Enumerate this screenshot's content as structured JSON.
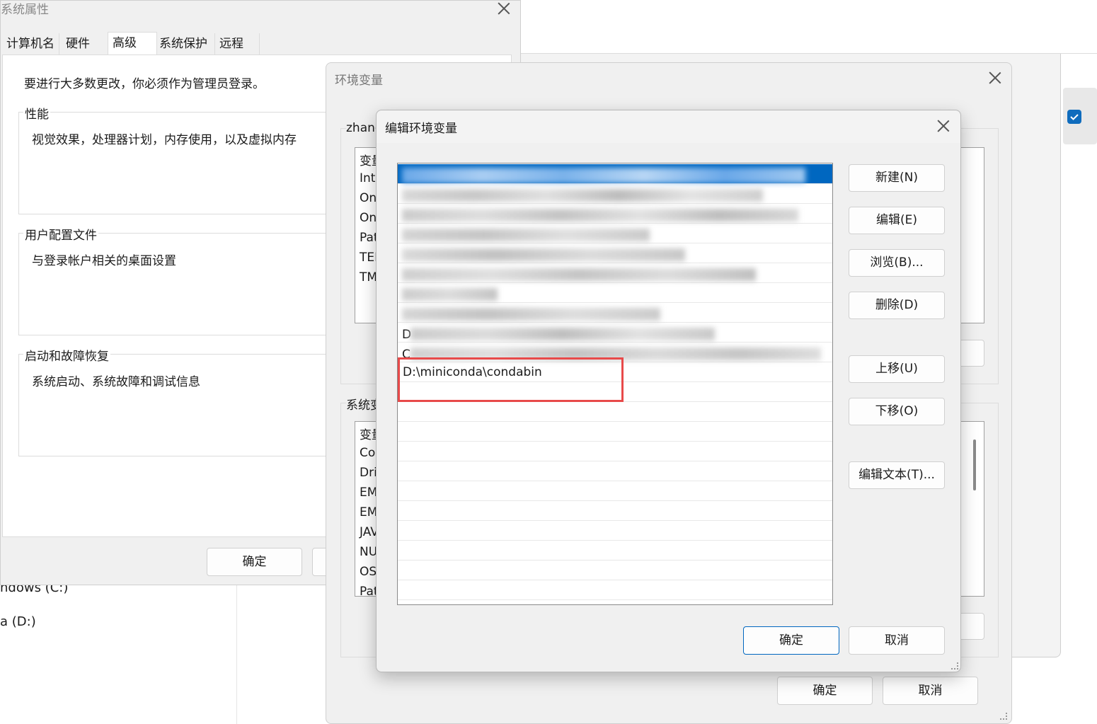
{
  "sys_props": {
    "title": "系统属性",
    "tabs": [
      "计算机名",
      "硬件",
      "高级",
      "系统保护",
      "远程"
    ],
    "admin_notice": "要进行大多数更改，你必须作为管理员登录。",
    "performance": {
      "title": "性能",
      "desc": "视觉效果，处理器计划，内存使用，以及虚拟内存"
    },
    "user_profiles": {
      "title": "用户配置文件",
      "desc": "与登录帐户相关的桌面设置"
    },
    "startup": {
      "title": "启动和故障恢复",
      "desc": "系统启动、系统故障和调试信息"
    },
    "ok_label": "确定"
  },
  "explorer_bg": {
    "drives": [
      "ndows (C:)",
      "a (D:)"
    ]
  },
  "env_vars": {
    "title": "环境变量",
    "user_section_label": "zhang",
    "user_vars_partial": [
      "变量",
      "Int",
      "On",
      "On",
      "Pat",
      "TEI",
      "TM"
    ],
    "system_section_label": "系统变",
    "system_vars_partial": [
      "变量",
      "Co",
      "Dri",
      "EM",
      "EM",
      "JAV",
      "NU",
      "OS",
      "Pat"
    ],
    "ok_label": "确定",
    "cancel_label": "取消"
  },
  "edit_env": {
    "title": "编辑环境变量",
    "partial_letters": [
      "D",
      "C"
    ],
    "new_entry": "D:\\miniconda\\condabin",
    "buttons": {
      "new": "新建(N)",
      "edit": "编辑(E)",
      "browse": "浏览(B)...",
      "delete": "删除(D)",
      "move_up": "上移(U)",
      "move_down": "下移(O)",
      "edit_text": "编辑文本(T)..."
    },
    "ok_label": "确定",
    "cancel_label": "取消"
  },
  "colors": {
    "selection": "#0067c0",
    "highlight_box": "#e84a4a",
    "checkbox": "#0f6cbd"
  }
}
